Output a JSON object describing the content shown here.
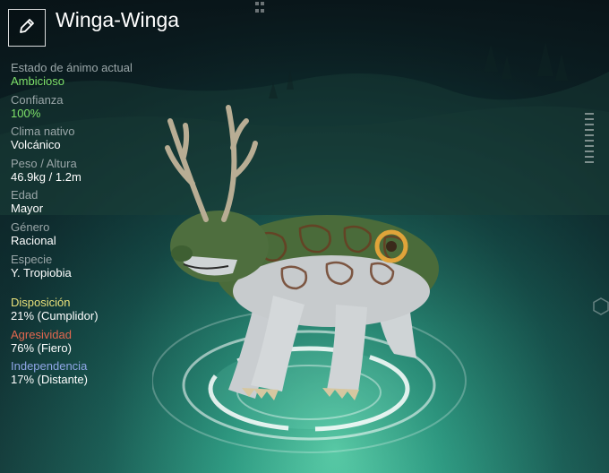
{
  "creature": {
    "name": "Winga-Winga",
    "edit_icon": "pencil-icon"
  },
  "stats": [
    {
      "label": "Estado de ánimo actual",
      "value": "Ambicioso",
      "value_color": "#7ee26a"
    },
    {
      "label": "Confianza",
      "value": "100%",
      "value_color": "#7ee26a"
    },
    {
      "label": "Clima nativo",
      "value": "Volcánico",
      "value_color": "#ffffff"
    },
    {
      "label": "Peso / Altura",
      "value": "46.9kg / 1.2m",
      "value_color": "#ffffff"
    },
    {
      "label": "Edad",
      "value": "Mayor",
      "value_color": "#ffffff"
    },
    {
      "label": "Género",
      "value": "Racional",
      "value_color": "#ffffff"
    },
    {
      "label": "Especie",
      "value": "Y. Tropiobia",
      "value_color": "#ffffff"
    }
  ],
  "traits": [
    {
      "label": "Disposición",
      "value": "21% (Cumplidor)",
      "label_color": "#e8e07a"
    },
    {
      "label": "Agresividad",
      "value": "76% (Fiero)",
      "label_color": "#e2674f"
    },
    {
      "label": "Independencia",
      "value": "17% (Distante)",
      "label_color": "#8fa6e6"
    }
  ]
}
